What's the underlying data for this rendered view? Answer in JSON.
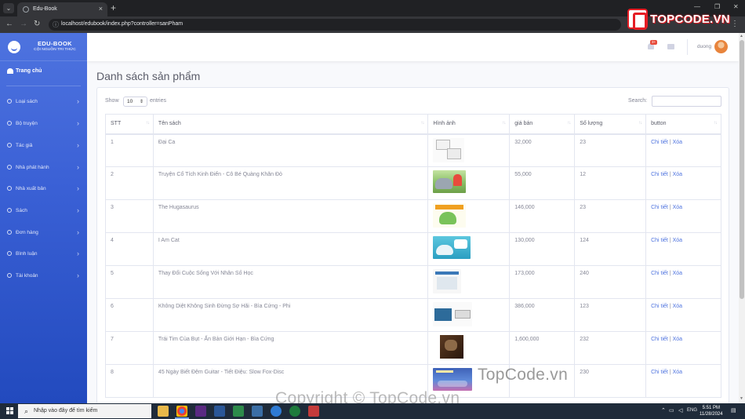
{
  "browser": {
    "tab_title": "Edu-Book",
    "url": "localhost/edubook/index.php?controller=sanPham"
  },
  "brand_overlay": {
    "text": "TOPCODE.VN",
    "color": "#e51c23"
  },
  "sidebar": {
    "brand_name": "EDU-BOOK",
    "brand_tagline": "CỘI NGUỒN TRI THỨC",
    "dashboard_label": "Trang chủ",
    "items": [
      {
        "label": "Loại sách"
      },
      {
        "label": "Bộ truyện"
      },
      {
        "label": "Tác giả"
      },
      {
        "label": "Nhà phát hành"
      },
      {
        "label": "Nhà xuất bản"
      },
      {
        "label": "Sách"
      },
      {
        "label": "Đơn hàng"
      },
      {
        "label": "Bình luận"
      },
      {
        "label": "Tài khoản"
      }
    ],
    "accent": "#4e73df"
  },
  "topbar": {
    "notification_count": "3+",
    "user_name": "duong"
  },
  "page": {
    "title": "Danh sách sản phẩm",
    "show_label": "Show",
    "page_length": "10",
    "entries_label": "entries",
    "search_label": "Search:"
  },
  "table": {
    "headers": [
      "STT",
      "Tên sách",
      "Hình ảnh",
      "giá bán",
      "Số lượng",
      "button"
    ],
    "detail_label": "Chi tiết",
    "delete_label": "Xóa",
    "divider": "|",
    "rows": [
      {
        "stt": "1",
        "name": "Đại Ca",
        "image": "cover-1",
        "price": "32,000",
        "qty": "23"
      },
      {
        "stt": "2",
        "name": "Truyện Cổ Tích Kinh Điển - Cô Bé Quàng Khăn Đỏ",
        "image": "cover-2",
        "price": "55,000",
        "qty": "12"
      },
      {
        "stt": "3",
        "name": "The Hugasaurus",
        "image": "cover-3",
        "price": "146,000",
        "qty": "23"
      },
      {
        "stt": "4",
        "name": "I Am Cat",
        "image": "cover-4",
        "price": "130,000",
        "qty": "124"
      },
      {
        "stt": "5",
        "name": "Thay Đổi Cuộc Sống Với Nhân Số Học",
        "image": "cover-5",
        "price": "173,000",
        "qty": "240"
      },
      {
        "stt": "6",
        "name": "Không Diệt Không Sinh Đừng Sợ Hãi - Bìa Cứng - Phi",
        "image": "cover-6",
        "price": "386,000",
        "qty": "123"
      },
      {
        "stt": "7",
        "name": "Trái Tim Của Bụt - Ấn Bản Giới Hạn - Bìa Cứng",
        "image": "cover-7",
        "price": "1,600,000",
        "qty": "232"
      },
      {
        "stt": "8",
        "name": "45 Ngày Biết Đệm Guitar - Tiết Điệu: Slow Fox-Disc",
        "image": "cover-8",
        "price": "",
        "qty": "230"
      }
    ]
  },
  "watermarks": {
    "primary": "TopCode.vn",
    "copyright": "Copyright © TopCode.vn"
  },
  "taskbar": {
    "search_placeholder": "Nhập vào đây để tìm kiếm",
    "language": "ENG",
    "time": "5:51 PM",
    "date": "11/28/2024"
  }
}
